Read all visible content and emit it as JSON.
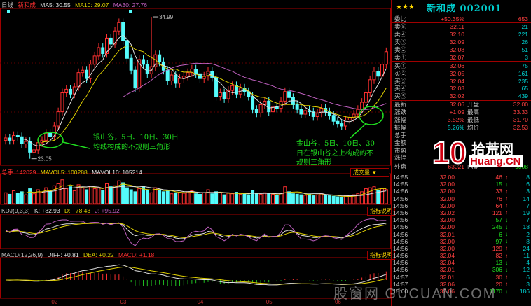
{
  "header": {
    "period": "日线",
    "stock_name": "新和成",
    "ma5": "MA5: 30.55",
    "ma10": "MA10: 29.07",
    "ma30": "MA30: 27.76"
  },
  "colors": {
    "up": "#ff3030",
    "down": "#54fcfc",
    "ma5": "#e0e0e0",
    "ma10": "#e0d000",
    "ma30": "#c060c0",
    "panel_border": "#a00000",
    "annotation": "#20e020"
  },
  "volume_header": {
    "label": "总手",
    "value": "142029",
    "mavol5": "MAVOL5: 100288",
    "mavol10": "MAVOL10: 105214",
    "selector": "成交量 ▼"
  },
  "kdj_header": {
    "label": "KDJ(9,3,3)",
    "k": "K: +82.93",
    "d": "D: +78.43",
    "j": "J: +95.92",
    "help": "指标说明"
  },
  "macd_header": {
    "label": "MACD(12,26,9)",
    "diff": "DIFF: +0.81",
    "dea": "DEA: +0.22",
    "macd": "MACD: +1.18",
    "help": "指标说明"
  },
  "annotations": {
    "silver_valley": [
      "银山谷，5日、10日、30日",
      "均线构成的不规则三角形"
    ],
    "golden_valley": [
      "金山谷，5日、10日、30",
      "日在银山谷之上构成的不",
      "规则三角形"
    ]
  },
  "chart_data": {
    "type": "candlestick",
    "title": "新和成 日线",
    "x_tick_labels": [
      "02",
      "03",
      "04",
      "05",
      "06"
    ],
    "x_tick_index": [
      12,
      29,
      48,
      65,
      82
    ],
    "y_range": [
      22.5,
      35.7
    ],
    "high_label": "34.99",
    "high_value": 34.99,
    "high_index": 36,
    "low_label": "23.05",
    "low_value": 23.05,
    "low_index": 6,
    "close": [
      24.8,
      24.6,
      25.0,
      24.9,
      24.3,
      24.5,
      23.6,
      23.8,
      24.4,
      24.6,
      25.2,
      24.9,
      25.8,
      27.0,
      28.6,
      28.9,
      28.5,
      29.1,
      30.3,
      30.5,
      29.8,
      31.0,
      31.7,
      32.4,
      31.9,
      33.2,
      32.7,
      33.8,
      34.5,
      33.0,
      31.5,
      30.5,
      29.0,
      31.4,
      31.0,
      30.2,
      30.8,
      31.8,
      31.2,
      30.5,
      29.6,
      30.1,
      29.4,
      29.8,
      30.0,
      30.3,
      30.6,
      30.2,
      29.8,
      30.0,
      30.4,
      29.9,
      28.3,
      28.6,
      28.1,
      28.8,
      29.2,
      28.5,
      29.0,
      28.7,
      28.3,
      27.2,
      26.9,
      27.6,
      27.9,
      27.0,
      27.4,
      27.3,
      27.9,
      28.7,
      28.2,
      27.6,
      27.2,
      26.8,
      27.1,
      27.0,
      26.6,
      26.9,
      27.3,
      27.0,
      26.7,
      26.2,
      26.0,
      25.8,
      26.3,
      26.5,
      26.8,
      27.2,
      27.8,
      28.6,
      29.7,
      30.4,
      30.0,
      31.0,
      32.06
    ],
    "volume_thousands": [
      110,
      95,
      130,
      105,
      120,
      90,
      150,
      100,
      140,
      115,
      160,
      120,
      180,
      200,
      240,
      150,
      170,
      130,
      190,
      160,
      140,
      175,
      150,
      160,
      130,
      200,
      170,
      180,
      230,
      210,
      160,
      140,
      120,
      150,
      170,
      130,
      110,
      160,
      140,
      120,
      130,
      100,
      110,
      115,
      105,
      120,
      130,
      100,
      95,
      110,
      140,
      100,
      120,
      110,
      90,
      105,
      100,
      115,
      95,
      100,
      90,
      130,
      105,
      95,
      110,
      100,
      95,
      85,
      105,
      170,
      120,
      100,
      95,
      90,
      85,
      95,
      80,
      90,
      100,
      85,
      80,
      75,
      70,
      65,
      80,
      75,
      90,
      100,
      120,
      150,
      160,
      170,
      130,
      150,
      142
    ],
    "ma_periods": [
      5,
      10,
      30
    ],
    "mavol_periods": [
      5,
      10
    ],
    "kdj_params": [
      9,
      3,
      3
    ],
    "macd_params": [
      12,
      26,
      9
    ]
  },
  "quote": {
    "stars": "★★★",
    "title": "新和成 002001",
    "weibi": {
      "label": "委比",
      "value": "+50.35%",
      "diff": "653"
    },
    "asks": [
      {
        "label": "卖⑤",
        "price": "32.11",
        "vol": "21"
      },
      {
        "label": "卖④",
        "price": "32.10",
        "vol": "221"
      },
      {
        "label": "卖③",
        "price": "32.09",
        "vol": "26"
      },
      {
        "label": "卖②",
        "price": "32.08",
        "vol": "51"
      },
      {
        "label": "卖①",
        "price": "32.07",
        "vol": "3"
      }
    ],
    "bids": [
      {
        "label": "买①",
        "price": "32.06",
        "vol": "75"
      },
      {
        "label": "买②",
        "price": "32.05",
        "vol": "161"
      },
      {
        "label": "买③",
        "price": "32.04",
        "vol": "235"
      },
      {
        "label": "买④",
        "price": "32.03",
        "vol": "65"
      },
      {
        "label": "买⑤",
        "price": "32.02",
        "vol": "439"
      }
    ],
    "stats": [
      {
        "l1": "最新",
        "v1": "32.06",
        "l2": "开盘",
        "v2": "32.00"
      },
      {
        "l1": "涨跌",
        "v1": "+1.09",
        "l2": "最高",
        "v2": "33.33"
      },
      {
        "l1": "涨幅",
        "v1": "+3.52%",
        "l2": "最低",
        "v2": "31.70"
      },
      {
        "l1": "振幅",
        "v1": "5.26%",
        "l2": "均价",
        "v2": "32.53"
      },
      {
        "l1": "总手",
        "v1": "",
        "l2": "",
        "v2": ""
      },
      {
        "l1": "金额",
        "v1": "",
        "l2": "",
        "v2": ""
      },
      {
        "l1": "市盈",
        "v1": "",
        "l2": "",
        "v2": ""
      },
      {
        "l1": "涨停",
        "v1": "",
        "l2": "",
        "v2": ""
      }
    ],
    "outer": {
      "label": "外盘",
      "value": "63021",
      "label2": "内盘",
      "value2": "79008"
    },
    "trades": [
      {
        "t": "14:55",
        "p": "32.00",
        "n": "46",
        "d": "up",
        "k": "8"
      },
      {
        "t": "14:55",
        "p": "32.00",
        "n": "15",
        "d": "dn",
        "k": "6"
      },
      {
        "t": "14:56",
        "p": "32.00",
        "n": "33",
        "d": "up",
        "k": "3"
      },
      {
        "t": "14:56",
        "p": "32.00",
        "n": "76",
        "d": "up",
        "k": "14"
      },
      {
        "t": "14:56",
        "p": "32.00",
        "n": "64",
        "d": "up",
        "k": "7"
      },
      {
        "t": "14:56",
        "p": "32.02",
        "n": "121",
        "d": "up",
        "k": "19"
      },
      {
        "t": "14:56",
        "p": "32.00",
        "n": "57",
        "d": "dn",
        "k": "7"
      },
      {
        "t": "14:56",
        "p": "32.00",
        "n": "245",
        "d": "dn",
        "k": "18"
      },
      {
        "t": "14:56",
        "p": "32.01",
        "n": "6",
        "d": "dn",
        "k": "2"
      },
      {
        "t": "14:56",
        "p": "32.00",
        "n": "97",
        "d": "dn",
        "k": "8"
      },
      {
        "t": "14:56",
        "p": "32.00",
        "n": "129",
        "d": "up",
        "k": "24"
      },
      {
        "t": "14:56",
        "p": "32.04",
        "n": "82",
        "d": "up",
        "k": "11"
      },
      {
        "t": "14:56",
        "p": "32.04",
        "n": "13",
        "d": "dn",
        "k": "4"
      },
      {
        "t": "14:56",
        "p": "32.01",
        "n": "306",
        "d": "dn",
        "k": "12"
      },
      {
        "t": "14:57",
        "p": "32.01",
        "n": "30",
        "d": "up",
        "k": "6"
      },
      {
        "t": "14:57",
        "p": "32.06",
        "n": "20",
        "d": "up",
        "k": "3"
      },
      {
        "t": "15:00",
        "p": "32.06",
        "n": "1170",
        "d": "dn",
        "k": "186"
      }
    ]
  },
  "watermarks": {
    "gucuan": "股窗网 GUCUAN.COM",
    "logo_num": "10",
    "logo_cn": "拾荒网",
    "logo_en": "Huang.CN"
  }
}
